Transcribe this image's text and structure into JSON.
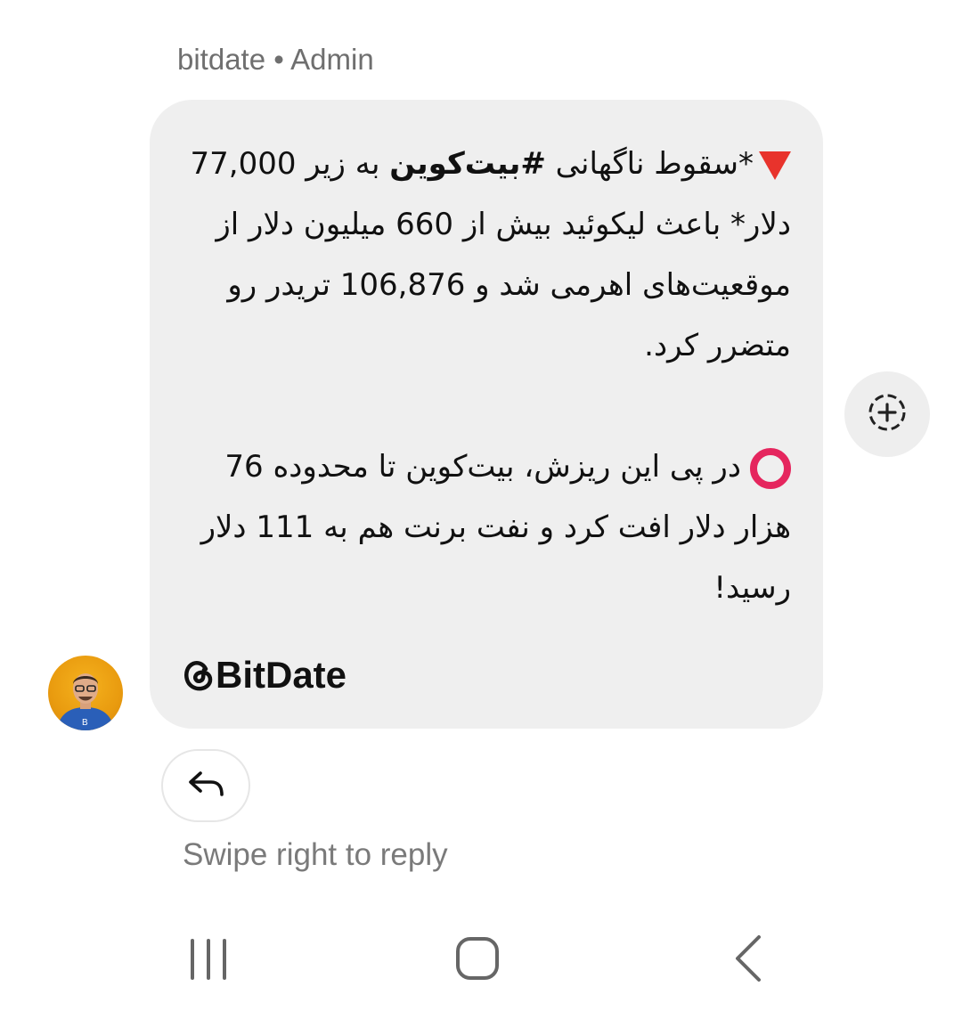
{
  "header": {
    "sender_line": "bitdate • Admin"
  },
  "message": {
    "para1_prefix": "*سقوط ناگهانی ",
    "para1_hashtag": "#بیت‌کوین",
    "para1_rest": " به زیر 77,000 دلار* باعث لیکوئید بیش از 660 میلیون دلار از موقعیت‌های اهرمی شد و 106,876 تریدر رو متضرر کرد.",
    "para2": "در پی این ریزش، بیت‌کوین تا محدوده 76 هزار دلار افت کرد و نفت برنت هم به 111 دلار رسید!",
    "signature": "BitDate"
  },
  "reply": {
    "hint": "Swipe right to reply"
  },
  "colors": {
    "bubble": "#efefef",
    "red_triangle": "#e8332c",
    "ring": "#e5265e",
    "muted_text": "#6f6f6f"
  },
  "icons": {
    "react": "add-reaction-icon",
    "reply": "reply-arrow-icon",
    "nav": [
      "recents-icon",
      "home-icon",
      "back-icon"
    ]
  }
}
